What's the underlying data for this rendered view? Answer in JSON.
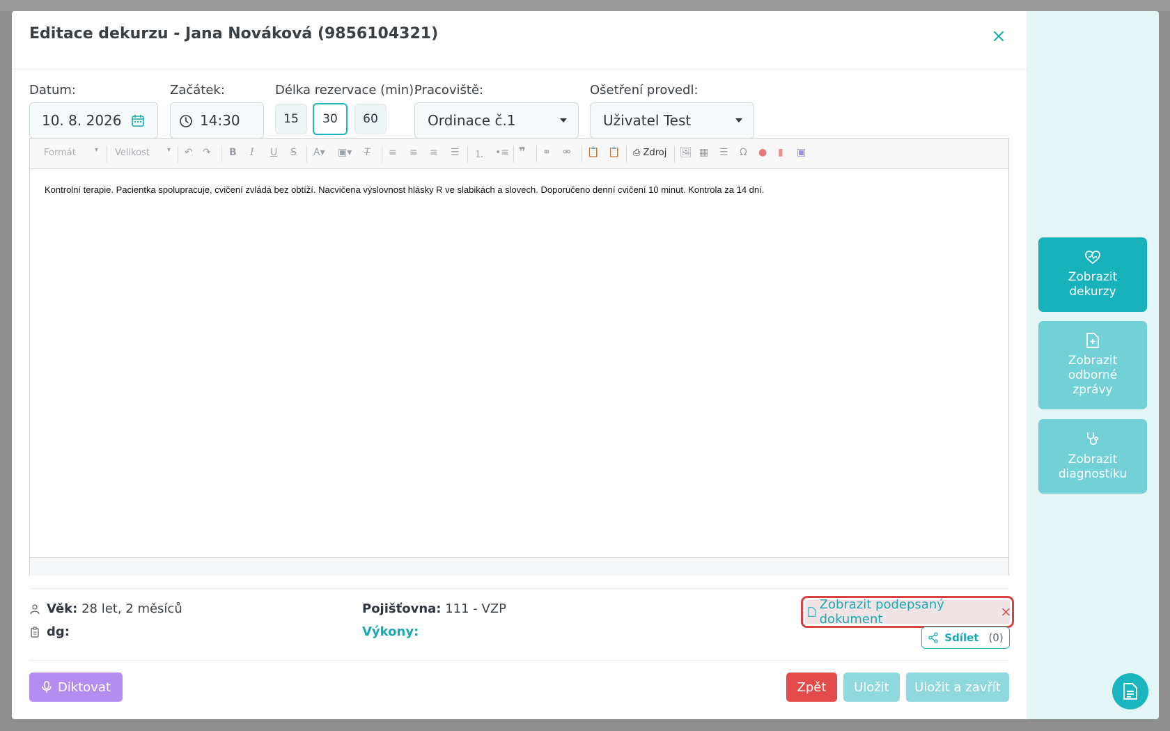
{
  "header": {
    "title": "Editace dekurzu - Jana Nováková (9856104321)"
  },
  "form": {
    "date_label": "Datum:",
    "date_value": "10. 8. 2026",
    "start_label": "Začátek:",
    "start_value": "14:30",
    "duration_label": "Délka rezervace (min):",
    "durations": [
      "15",
      "30",
      "60"
    ],
    "selected_duration": "30",
    "workplace_label": "Pracoviště:",
    "workplace_value": "Ordinace č.1",
    "performer_label": "Ošetření provedl:",
    "performer_value": "Uživatel Test"
  },
  "toolbar": {
    "format_label": "Formát",
    "size_label": "Velikost",
    "source_label": "Zdroj"
  },
  "editor": {
    "content": "Kontrolní terapie. Pacientka spolupracuje, cvičení zvládá bez obtíží. Nacvičena výslovnost hlásky R ve slabikách a slovech. Doporučeno denní cvičení 10 minut. Kontrola za 14 dní."
  },
  "info": {
    "age_label": "Věk:",
    "age_value": "28 let, 2 měsíců",
    "dg_label": "dg:",
    "insurance_label": "Pojišťovna:",
    "insurance_value": "111 - VZP",
    "procedures_label": "Výkony:",
    "signed_document_label": "Zobrazit podepsaný dokument",
    "share_label": "Sdílet",
    "share_count": "(0)"
  },
  "footer": {
    "dictate_label": "Diktovat",
    "back_label": "Zpět",
    "save_label": "Uložit",
    "save_close_label": "Uložit a zavřít"
  },
  "side_panel": {
    "records_line1": "Zobrazit",
    "records_line2": "dekurzy",
    "reports_line1": "Zobrazit",
    "reports_line2": "odborné",
    "reports_line3": "zprávy",
    "diag_line1": "Zobrazit",
    "diag_line2": "diagnostiku"
  },
  "colors": {
    "accent": "#1bb5bf",
    "danger": "#e34b4b",
    "dictate": "#b58df0",
    "disabled_accent": "#8fd8de"
  }
}
